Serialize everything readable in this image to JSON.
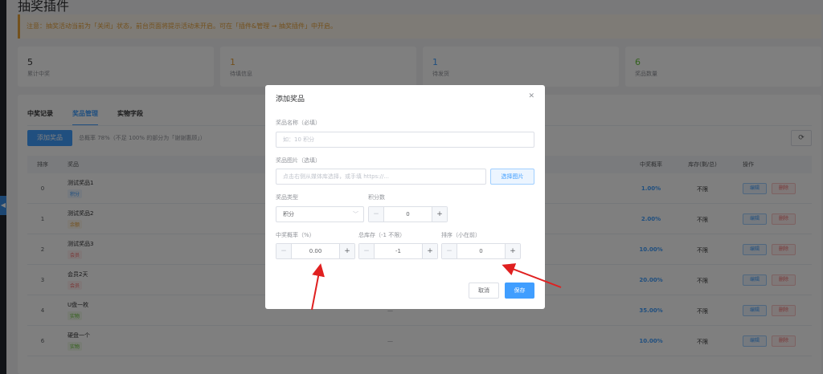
{
  "page": {
    "title": "抽奖插件",
    "notice": "注意：抽奖活动当前为「关闭」状态，前台页面将提示活动未开启。可在「插件&管理 → 抽奖插件」中开启。"
  },
  "stats": [
    {
      "value": "5",
      "label": "累计中奖",
      "color": "#303133"
    },
    {
      "value": "1",
      "label": "待填信息",
      "color": "#e6a23c"
    },
    {
      "value": "1",
      "label": "待发货",
      "color": "#409eff"
    },
    {
      "value": "6",
      "label": "奖品数量",
      "color": "#67c23a"
    }
  ],
  "tabs": [
    {
      "label": "中奖记录",
      "active": false
    },
    {
      "label": "奖品管理",
      "active": true
    },
    {
      "label": "实物字段",
      "active": false
    }
  ],
  "toolbar": {
    "add_label": "添加奖品",
    "hint": "总概率 78%（不足 100% 的部分为「谢谢惠顾」）",
    "refresh_icon": "refresh-icon"
  },
  "table": {
    "headers": {
      "sort": "排序",
      "name": "奖品",
      "prob": "中奖概率",
      "stock": "库存(剩/总)",
      "ops": "操作"
    },
    "edit_label": "编辑",
    "delete_label": "删除",
    "rows": [
      {
        "sort": "0",
        "name": "测试奖品1",
        "tag": "积分",
        "tag_color": "#409eff",
        "tag_bg": "#ecf5ff",
        "desc": "",
        "prob": "1.00%",
        "stock": "不限"
      },
      {
        "sort": "1",
        "name": "测试奖品2",
        "tag": "余额",
        "tag_color": "#e6a23c",
        "tag_bg": "#fdf6ec",
        "desc": "",
        "prob": "2.00%",
        "stock": "不限"
      },
      {
        "sort": "2",
        "name": "测试奖品3",
        "tag": "会员",
        "tag_color": "#f56c6c",
        "tag_bg": "#fef0f0",
        "desc": "",
        "prob": "10.00%",
        "stock": "不限"
      },
      {
        "sort": "3",
        "name": "会员2天",
        "tag": "会员",
        "tag_color": "#f56c6c",
        "tag_bg": "#fef0f0",
        "desc": "",
        "prob": "20.00%",
        "stock": "不限"
      },
      {
        "sort": "4",
        "name": "U盘一枚",
        "tag": "实物",
        "tag_color": "#67c23a",
        "tag_bg": "#f0f9eb",
        "desc": "—",
        "prob": "35.00%",
        "stock": "不限"
      },
      {
        "sort": "6",
        "name": "硬盘一个",
        "tag": "实物",
        "tag_color": "#67c23a",
        "tag_bg": "#f0f9eb",
        "desc": "—",
        "prob": "10.00%",
        "stock": "不限"
      }
    ]
  },
  "dialog": {
    "title": "添加奖品",
    "close_icon": "close-icon",
    "name_label": "奖品名称（必填）",
    "name_placeholder": "如：10 积分",
    "image_label": "奖品图片（选填）",
    "image_placeholder": "点击右侧从媒体库选择，或手填 https://...",
    "pick_image_label": "选择图片",
    "type_label": "奖品类型",
    "type_value": "积分",
    "points_label": "积分数",
    "points_value": "0",
    "prob_label": "中奖概率（%）",
    "prob_value": "0.00",
    "stock_label": "总库存（-1 不限）",
    "stock_value": "-1",
    "sort_label": "排序（小在前）",
    "sort_value": "0",
    "cancel_label": "取消",
    "save_label": "保存"
  }
}
